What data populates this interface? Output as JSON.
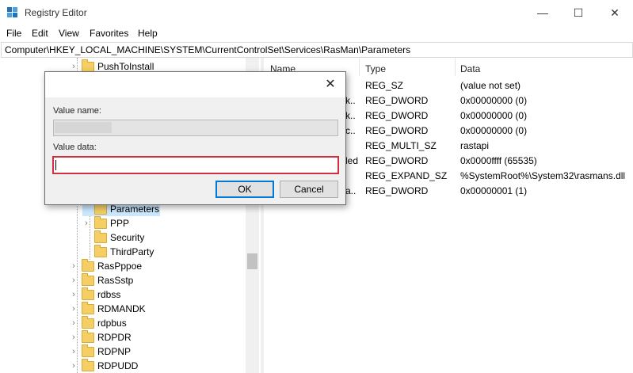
{
  "window": {
    "title": "Registry Editor",
    "controls": {
      "minimize": "—",
      "maximize": "☐",
      "close": "✕"
    }
  },
  "menu": [
    "File",
    "Edit",
    "View",
    "Favorites",
    "Help"
  ],
  "address": "Computer\\HKEY_LOCAL_MACHINE\\SYSTEM\\CurrentControlSet\\Services\\RasMan\\Parameters",
  "tree": {
    "items": [
      {
        "label": "PushToInstall"
      },
      {
        "label": "Parameters"
      },
      {
        "label": "PPP"
      },
      {
        "label": "Security"
      },
      {
        "label": "ThirdParty"
      },
      {
        "label": "RasPppoe"
      },
      {
        "label": "RasSstp"
      },
      {
        "label": "rdbss"
      },
      {
        "label": "RDMANDK"
      },
      {
        "label": "rdpbus"
      },
      {
        "label": "RDPDR"
      },
      {
        "label": "RDPNP"
      },
      {
        "label": "RDPUDD"
      }
    ]
  },
  "list": {
    "headers": {
      "name": "Name",
      "type": "Type",
      "data": "Data"
    },
    "rows": [
      {
        "name": "",
        "type": "REG_SZ",
        "data": "(value not set)"
      },
      {
        "name": "k..",
        "type": "REG_DWORD",
        "data": "0x00000000 (0)"
      },
      {
        "name": "k..",
        "type": "REG_DWORD",
        "data": "0x00000000 (0)"
      },
      {
        "name": "c..",
        "type": "REG_DWORD",
        "data": "0x00000000 (0)"
      },
      {
        "name": "",
        "type": "REG_MULTI_SZ",
        "data": "rastapi"
      },
      {
        "name": "led",
        "type": "REG_DWORD",
        "data": "0x0000ffff (65535)"
      },
      {
        "name": "",
        "type": "REG_EXPAND_SZ",
        "data": "%SystemRoot%\\System32\\rasmans.dll"
      },
      {
        "name": "a..",
        "type": "REG_DWORD",
        "data": "0x00000001 (1)"
      }
    ]
  },
  "dialog": {
    "close_glyph": "✕",
    "value_name_label": "Value name:",
    "value_data_label": "Value data:",
    "value_data": "",
    "ok_label": "OK",
    "cancel_label": "Cancel"
  }
}
